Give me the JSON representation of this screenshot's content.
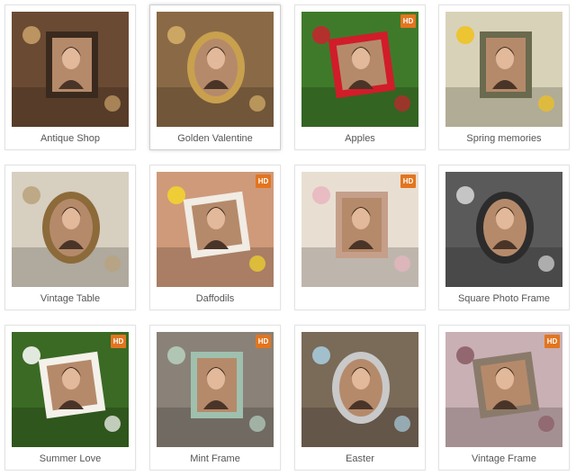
{
  "gallery": {
    "badge": "HD",
    "items": [
      {
        "id": "antique-shop",
        "title": "Antique Shop",
        "hd": false,
        "bg": "#6b4a33",
        "accent": "#c9a16a",
        "frame": "#3a2a1e"
      },
      {
        "id": "golden-valentine",
        "title": "Golden Valentine",
        "hd": false,
        "bg": "#8a6a46",
        "accent": "#d7b068",
        "frame": "#c9a04e"
      },
      {
        "id": "apples",
        "title": "Apples",
        "hd": true,
        "bg": "#3f7a2a",
        "accent": "#c8232e",
        "frame": "#d11c2a"
      },
      {
        "id": "spring-memories",
        "title": "Spring memories",
        "hd": false,
        "bg": "#d8d2b8",
        "accent": "#f1c21a",
        "frame": "#6a6a4e"
      },
      {
        "id": "vintage-table",
        "title": "Vintage Table",
        "hd": false,
        "bg": "#d7cfc0",
        "accent": "#b9a27a",
        "frame": "#8c6a3a"
      },
      {
        "id": "daffodils",
        "title": "Daffodils",
        "hd": true,
        "bg": "#cf9a7a",
        "accent": "#f3d62a",
        "frame": "#f1ece4"
      },
      {
        "id": "vintage-oval",
        "title": "",
        "hd": true,
        "bg": "#e8dfd2",
        "accent": "#e8b6c0",
        "frame": "#c59f8a"
      },
      {
        "id": "square-photo-frame",
        "title": "Square Photo Frame",
        "hd": false,
        "bg": "#5a5a5a",
        "accent": "#d8d8d8",
        "frame": "#2c2c2c"
      },
      {
        "id": "summer-love",
        "title": "Summer Love",
        "hd": true,
        "bg": "#3a6a24",
        "accent": "#ffffff",
        "frame": "#f4f1ea"
      },
      {
        "id": "mint-frame",
        "title": "Mint Frame",
        "hd": true,
        "bg": "#8a8278",
        "accent": "#b7d1c0",
        "frame": "#9fc0ae"
      },
      {
        "id": "easter",
        "title": "Easter",
        "hd": false,
        "bg": "#7a6a58",
        "accent": "#a9cfe0",
        "frame": "#c9c9c9"
      },
      {
        "id": "vintage-frame",
        "title": "Vintage Frame",
        "hd": true,
        "bg": "#c9b0b4",
        "accent": "#8a5a64",
        "frame": "#8a7a6a"
      }
    ]
  },
  "colors": {
    "card_border": "#e3e3e3",
    "caption_text": "#555555",
    "hd_badge": "#e2751f"
  }
}
